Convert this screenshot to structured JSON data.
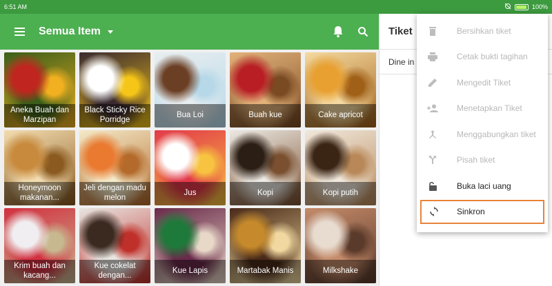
{
  "status": {
    "time": "6:51 AM",
    "battery": "100%"
  },
  "appbar": {
    "title": "Semua Item"
  },
  "items": [
    {
      "name": "Aneka Buah dan Marzipan",
      "colors": [
        "#c0261f",
        "#3a5e1a",
        "#f0b020"
      ]
    },
    {
      "name": "Black Sticky Rice Porridge",
      "colors": [
        "#ffffff",
        "#3a2a30",
        "#f5c518"
      ]
    },
    {
      "name": "Bua Loi",
      "colors": [
        "#6b3f24",
        "#e8eef0",
        "#b6d8e8"
      ]
    },
    {
      "name": "Buah kue",
      "colors": [
        "#b81e24",
        "#e2b27a",
        "#7a4a22"
      ]
    },
    {
      "name": "Cake apricot",
      "colors": [
        "#e8a030",
        "#f4d9a0",
        "#a06018"
      ]
    },
    {
      "name": "Honeymoon makanan...",
      "colors": [
        "#c88a3c",
        "#f2dcb0",
        "#8a5a20"
      ]
    },
    {
      "name": "Jeli dengan madu melon",
      "colors": [
        "#e97a30",
        "#f4e9c8",
        "#b36a2a"
      ]
    },
    {
      "name": "Jus",
      "colors": [
        "#ffffff",
        "#e23a4a",
        "#f7c340"
      ]
    },
    {
      "name": "Kopi",
      "colors": [
        "#2b1e14",
        "#ece8e2",
        "#7a5030"
      ]
    },
    {
      "name": "Kopi putih",
      "colors": [
        "#3a2414",
        "#f0e8dc",
        "#b88858"
      ]
    },
    {
      "name": "Krim buah dan kacang...",
      "colors": [
        "#f0eef0",
        "#d23040",
        "#c8b890"
      ]
    },
    {
      "name": "Kue cokelat dengan...",
      "colors": [
        "#3a2a20",
        "#e8e4e0",
        "#c0302a"
      ]
    },
    {
      "name": "Kue Lapis",
      "colors": [
        "#1e7a3a",
        "#6a2a4a",
        "#e8d8c8"
      ]
    },
    {
      "name": "Martabak Manis",
      "colors": [
        "#c68a2c",
        "#4a2a18",
        "#f0d8a0"
      ]
    },
    {
      "name": "Milkshake",
      "colors": [
        "#e8dcd0",
        "#c48a6a",
        "#5a3a2a"
      ]
    }
  ],
  "ticket": {
    "title": "Tiket",
    "dining": "Dine in"
  },
  "menu": [
    {
      "label": "Bersihkan tiket",
      "icon": "trash-icon",
      "enabled": false
    },
    {
      "label": "Cetak bukti tagihan",
      "icon": "printer-icon",
      "enabled": false
    },
    {
      "label": "Mengedit Tiket",
      "icon": "pencil-icon",
      "enabled": false
    },
    {
      "label": "Menetapkan Tiket",
      "icon": "assign-person-icon",
      "enabled": false
    },
    {
      "label": "Menggabungkan tiket",
      "icon": "merge-icon",
      "enabled": false
    },
    {
      "label": "Pisah tiket",
      "icon": "split-icon",
      "enabled": false
    },
    {
      "label": "Buka laci uang",
      "icon": "unlock-icon",
      "enabled": true
    },
    {
      "label": "Sinkron",
      "icon": "sync-icon",
      "enabled": true,
      "highlighted": true
    }
  ],
  "colors": {
    "appbar": "#4caf50",
    "statusbar": "#3c9a3f",
    "highlight": "#e8833a"
  }
}
